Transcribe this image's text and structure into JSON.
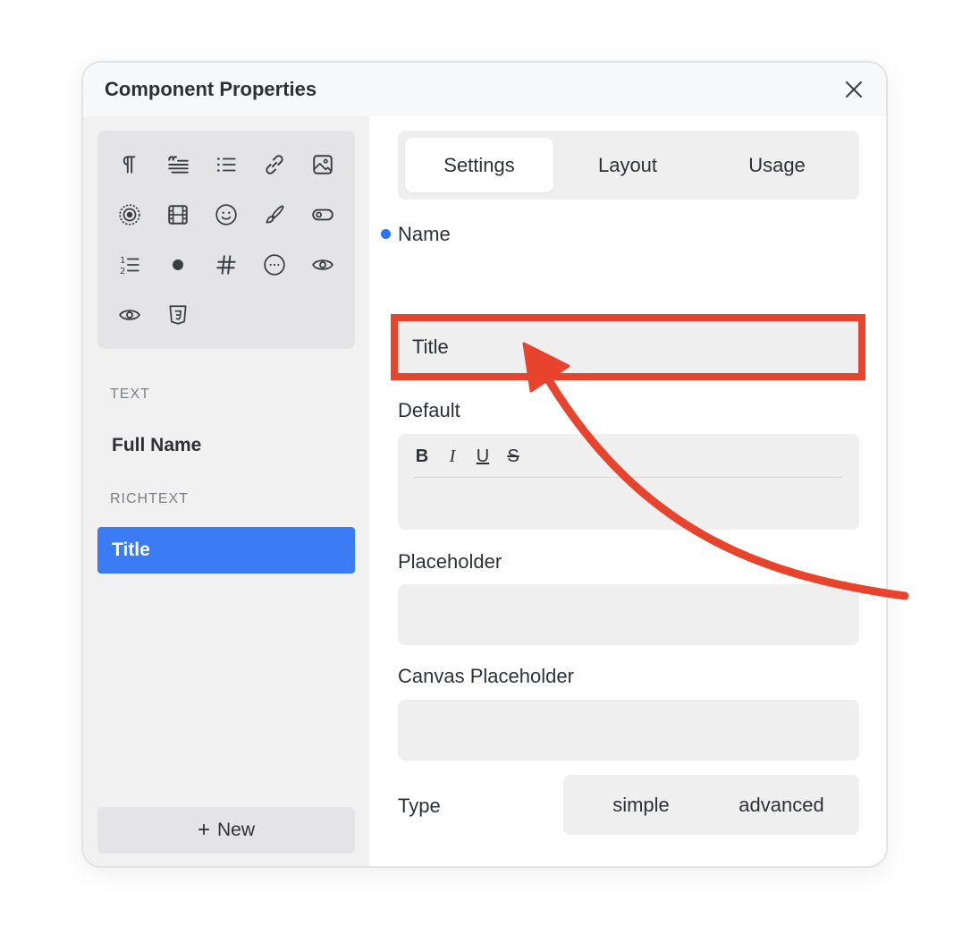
{
  "dialog": {
    "title": "Component Properties",
    "close_icon": "close-icon"
  },
  "sidebar": {
    "icons": [
      "paragraph-icon",
      "blockquote-icon",
      "bullet-list-icon",
      "link-icon",
      "image-icon",
      "radio-target-icon",
      "film-icon",
      "smiley-icon",
      "brush-icon",
      "toggle-icon",
      "numbered-list-icon",
      "dot-icon",
      "hash-icon",
      "more-circle-icon",
      "eye-icon",
      "eye-icon",
      "css3-icon"
    ],
    "sections": [
      {
        "label": "TEXT",
        "items": [
          "Full Name"
        ]
      },
      {
        "label": "RICHTEXT",
        "items": [
          "Title"
        ]
      }
    ],
    "selected_item": "Title",
    "new_button": {
      "plus": "+",
      "label": "New"
    }
  },
  "tabs": [
    "Settings",
    "Layout",
    "Usage"
  ],
  "active_tab": "Settings",
  "form": {
    "name_label": "Name",
    "name_value": "Title",
    "default_label": "Default",
    "rte_buttons": [
      "B",
      "I",
      "U",
      "S"
    ],
    "placeholder_label": "Placeholder",
    "placeholder_value": "",
    "canvas_placeholder_label": "Canvas Placeholder",
    "canvas_placeholder_value": "",
    "type_label": "Type",
    "type_options": [
      "simple",
      "advanced"
    ]
  },
  "colors": {
    "accent": "#3b7cf4",
    "indicator_dot": "#2f74f5",
    "highlight": "#e8432d"
  }
}
